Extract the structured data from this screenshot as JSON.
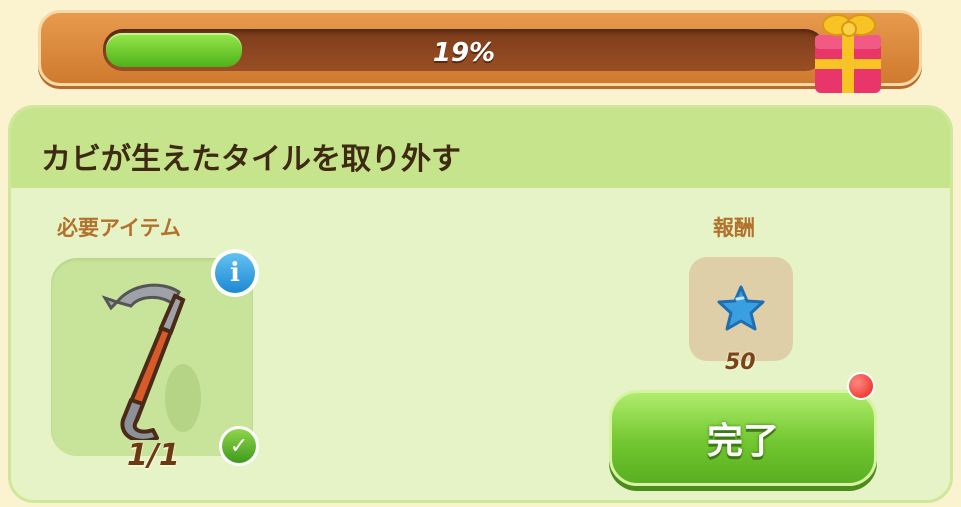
{
  "progress": {
    "value": 0.19,
    "label": "19%"
  },
  "quest": {
    "title": "カビが生えたタイルを取り外す",
    "required_label": "必要アイテム",
    "required_item": {
      "icon": "crowbar-icon",
      "count": "1/1"
    },
    "reward_label": "報酬",
    "reward": {
      "icon": "blue-star-icon",
      "amount": "50"
    },
    "complete_label": "完了"
  },
  "colors": {
    "progress_fill": "#6cc82b",
    "button_green": "#72c630",
    "header_green": "#c5e48b",
    "notification_red": "#e8231c"
  }
}
